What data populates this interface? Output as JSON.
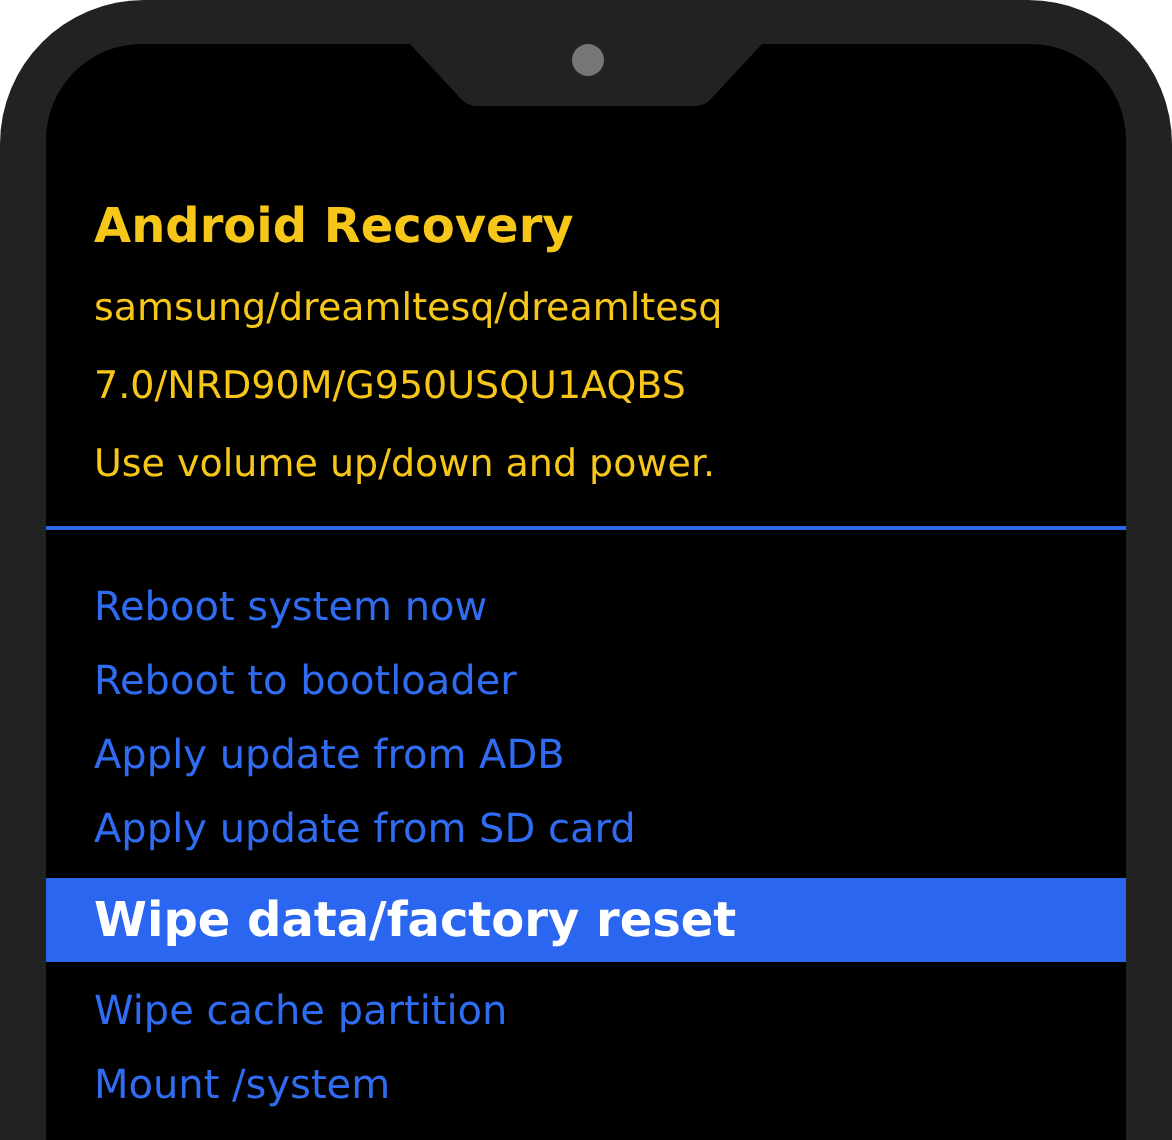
{
  "header": {
    "title": "Android Recovery",
    "lines": [
      "samsung/dreamltesq/dreamltesq",
      "7.0/NRD90M/G950USQU1AQBS",
      "Use volume up/down and power."
    ]
  },
  "menu": [
    {
      "label": "Reboot system now",
      "selected": false
    },
    {
      "label": "Reboot to bootloader",
      "selected": false
    },
    {
      "label": "Apply update from ADB",
      "selected": false
    },
    {
      "label": "Apply update from SD card",
      "selected": false
    },
    {
      "label": "Wipe data/factory reset",
      "selected": true
    },
    {
      "label": "Wipe cache partition",
      "selected": false
    },
    {
      "label": "Mount /system",
      "selected": false
    }
  ]
}
